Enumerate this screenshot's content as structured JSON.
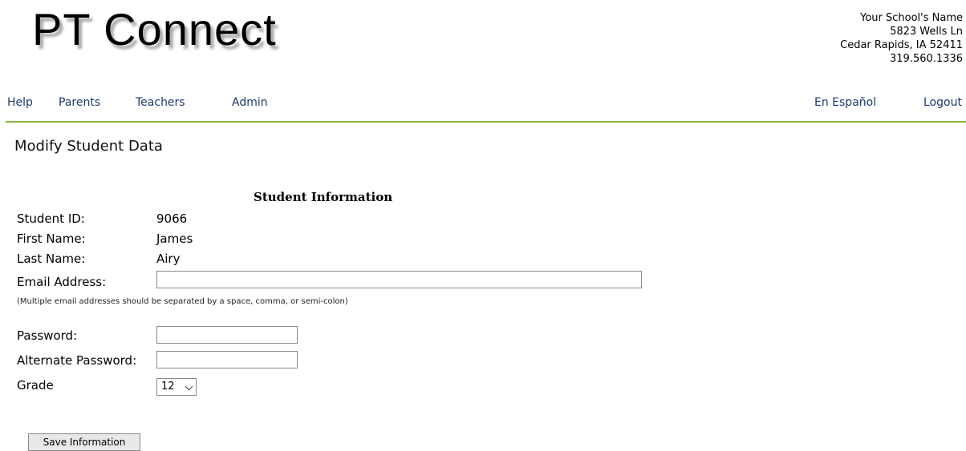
{
  "brand": {
    "logo_text": "PT Connect"
  },
  "school": {
    "name": "Your School's Name",
    "street": "5823 Wells Ln",
    "city_state_zip": "Cedar Rapids, IA 52411",
    "phone": "319.560.1336"
  },
  "nav": {
    "left": [
      "Help",
      "Parents",
      "Teachers",
      "Admin"
    ],
    "language": "En Español",
    "logout": "Logout"
  },
  "page": {
    "title": "Modify Student Data"
  },
  "form": {
    "section_title": "Student Information",
    "student_id_label": "Student ID:",
    "student_id": "9066",
    "first_name_label": "First Name:",
    "first_name": "James",
    "last_name_label": "Last Name:",
    "last_name": "Airy",
    "email_label": "Email Address:",
    "email_value": "",
    "email_hint": "(Multiple email addresses should be separated by a space, comma, or semi-colon)",
    "password_label": "Password:",
    "password_value": "",
    "alt_password_label": "Alternate Password:",
    "alt_password_value": "",
    "grade_label": "Grade",
    "grade_selected": "12",
    "save_label": "Save Information"
  },
  "colors": {
    "nav_link": "#1a3a6b",
    "nav_rule": "#8bb040"
  }
}
